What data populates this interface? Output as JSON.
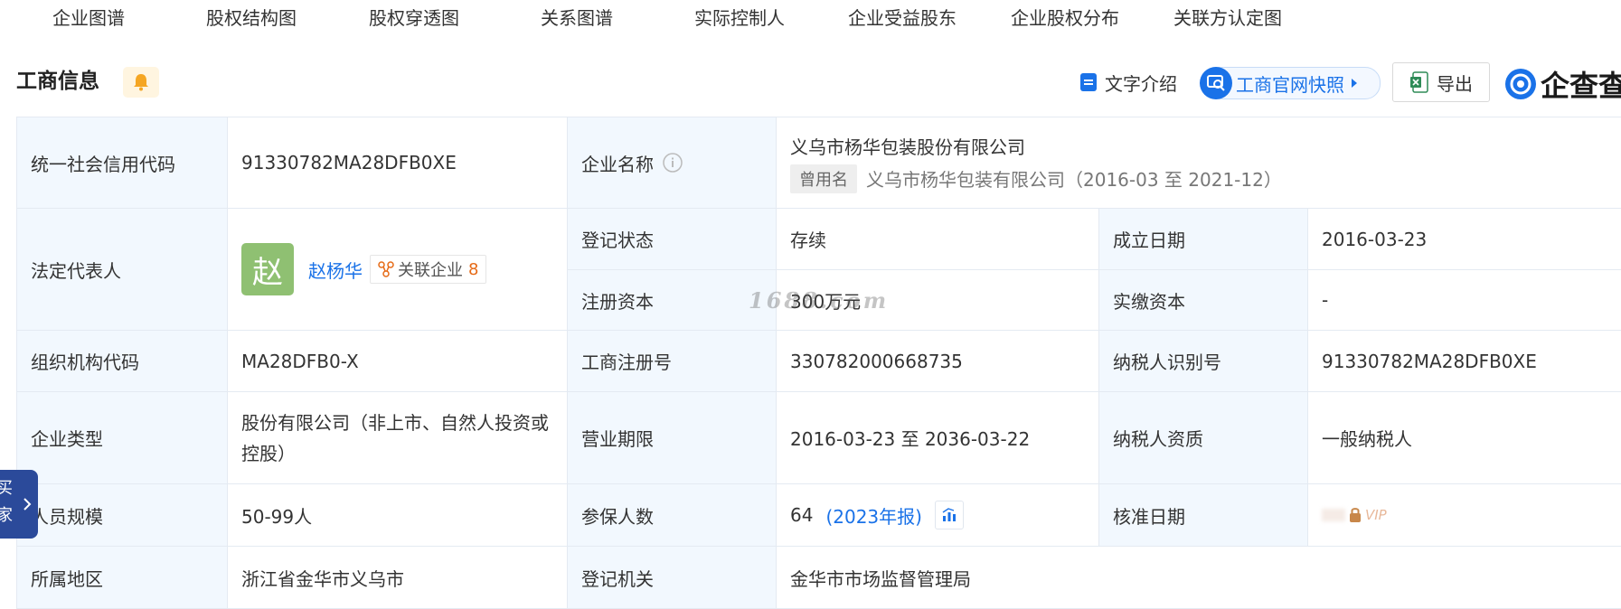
{
  "tabs": [
    "企业图谱",
    "股权结构图",
    "股权穿透图",
    "关系图谱",
    "实际控制人",
    "企业受益股东",
    "企业股权分布",
    "关联方认定图"
  ],
  "header": {
    "title": "工商信息",
    "text_intro": "文字介绍",
    "snapshot": "工商官网快照",
    "export": "导出",
    "brand": "企查查"
  },
  "info": {
    "credit_code_label": "统一社会信用代码",
    "credit_code": "91330782MA28DFB0XE",
    "company_name_label": "企业名称",
    "company_name": "义乌市杨华包装股份有限公司",
    "former_name_tag": "曾用名",
    "former_name": "义乌市杨华包装有限公司（2016-03 至 2021-12）",
    "legal_rep_label": "法定代表人",
    "legal_rep_avatar": "赵",
    "legal_rep_name": "赵杨华",
    "related_label": "关联企业",
    "related_count": "8",
    "reg_status_label": "登记状态",
    "reg_status": "存续",
    "founded_label": "成立日期",
    "founded": "2016-03-23",
    "reg_capital_label": "注册资本",
    "reg_capital": "300万元",
    "paid_capital_label": "实缴资本",
    "paid_capital": "-",
    "org_code_label": "组织机构代码",
    "org_code": "MA28DFB0-X",
    "biz_reg_no_label": "工商注册号",
    "biz_reg_no": "330782000668735",
    "taxpayer_id_label": "纳税人识别号",
    "taxpayer_id": "91330782MA28DFB0XE",
    "type_label": "企业类型",
    "type": "股份有限公司（非上市、自然人投资或控股）",
    "term_label": "营业期限",
    "term": "2016-03-23 至 2036-03-22",
    "taxpayer_qual_label": "纳税人资质",
    "taxpayer_qual": "一般纳税人",
    "staff_label": "人员规模",
    "staff": "50-99人",
    "insured_label": "参保人数",
    "insured": "64",
    "insured_report": "(2023年报)",
    "approve_label": "核准日期",
    "approve_vip": "VIP",
    "region_label": "所属地区",
    "region": "浙江省金华市义乌市",
    "authority_label": "登记机关",
    "authority": "金华市市场监督管理局"
  },
  "watermark": "1688.com",
  "side_float_text": "买 家"
}
